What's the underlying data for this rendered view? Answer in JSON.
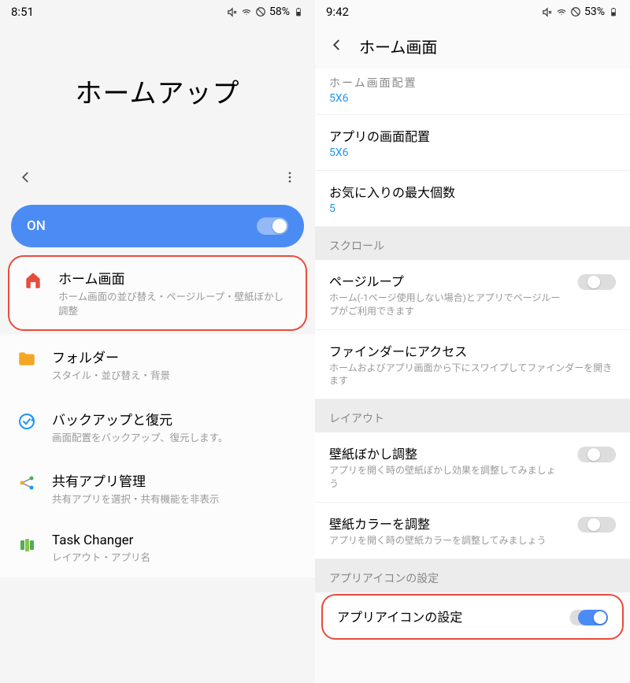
{
  "left": {
    "status": {
      "time": "8:51",
      "battery": "58%"
    },
    "app_title": "ホームアップ",
    "toggle_label": "ON",
    "items": [
      {
        "title": "ホーム画面",
        "subtitle": "ホーム画面の並び替え・ページループ・壁紙ぼかし調整"
      },
      {
        "title": "フォルダー",
        "subtitle": "スタイル・並び替え・背景"
      },
      {
        "title": "バックアップと復元",
        "subtitle": "画面配置をバックアップ、復元します。"
      },
      {
        "title": "共有アプリ管理",
        "subtitle": "共有アプリを選択・共有機能を非表示"
      },
      {
        "title": "Task Changer",
        "subtitle": "レイアウト・アプリ名"
      }
    ]
  },
  "right": {
    "status": {
      "time": "9:42",
      "battery": "53%"
    },
    "header_title": "ホーム画面",
    "partial_top": {
      "title": "ホーム画面配置",
      "value": "5X6"
    },
    "grid_settings": [
      {
        "title": "アプリの画面配置",
        "value": "5X6"
      },
      {
        "title": "お気に入りの最大個数",
        "value": "5"
      }
    ],
    "sections": {
      "scroll": {
        "label": "スクロール",
        "items": [
          {
            "title": "ページループ",
            "desc": "ホーム(-1ページ使用しない場合)とアプリでページループがご利用できます"
          },
          {
            "title": "ファインダーにアクセス",
            "desc": "ホームおよびアプリ画面から下にスワイプしてファインダーを開きます"
          }
        ]
      },
      "layout": {
        "label": "レイアウト",
        "items": [
          {
            "title": "壁紙ぼかし調整",
            "desc": "アプリを開く時の壁紙ぼかし効果を調整してみましょう"
          },
          {
            "title": "壁紙カラーを調整",
            "desc": "アプリを開く時の壁紙カラーを調整してみましょう"
          }
        ]
      },
      "app_icon": {
        "label": "アプリアイコンの設定",
        "item": {
          "title": "アプリアイコンの設定"
        }
      }
    }
  }
}
